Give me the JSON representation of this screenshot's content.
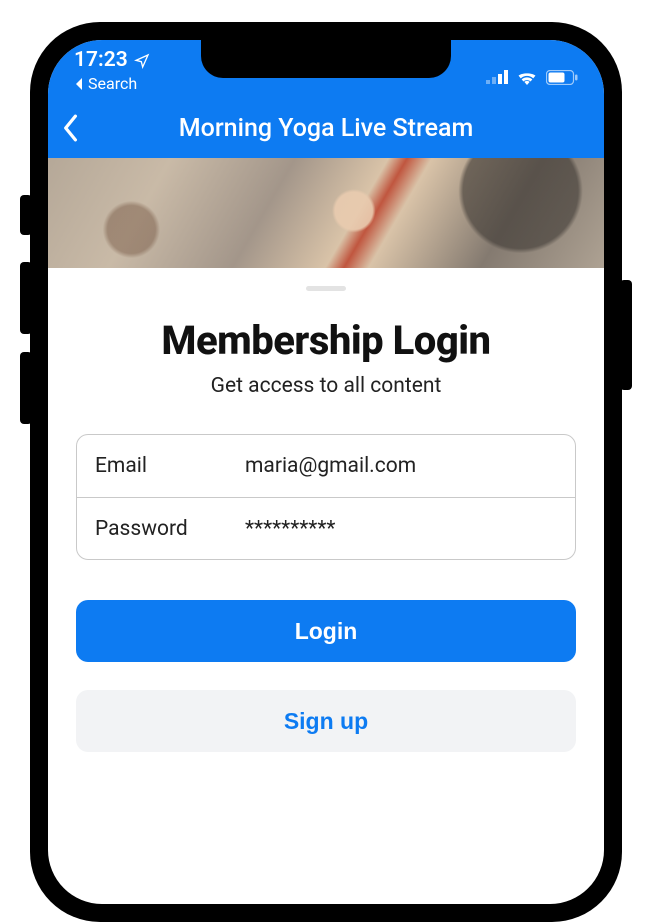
{
  "status": {
    "time": "17:23",
    "back_app_label": "Search"
  },
  "nav": {
    "title": "Morning Yoga Live Stream"
  },
  "sheet": {
    "title": "Membership Login",
    "subtitle": "Get access to all content"
  },
  "form": {
    "email": {
      "label": "Email",
      "value": "maria@gmail.com"
    },
    "password": {
      "label": "Password",
      "value": "**********"
    }
  },
  "buttons": {
    "login": "Login",
    "signup": "Sign up"
  },
  "colors": {
    "accent": "#0d7bf2"
  }
}
